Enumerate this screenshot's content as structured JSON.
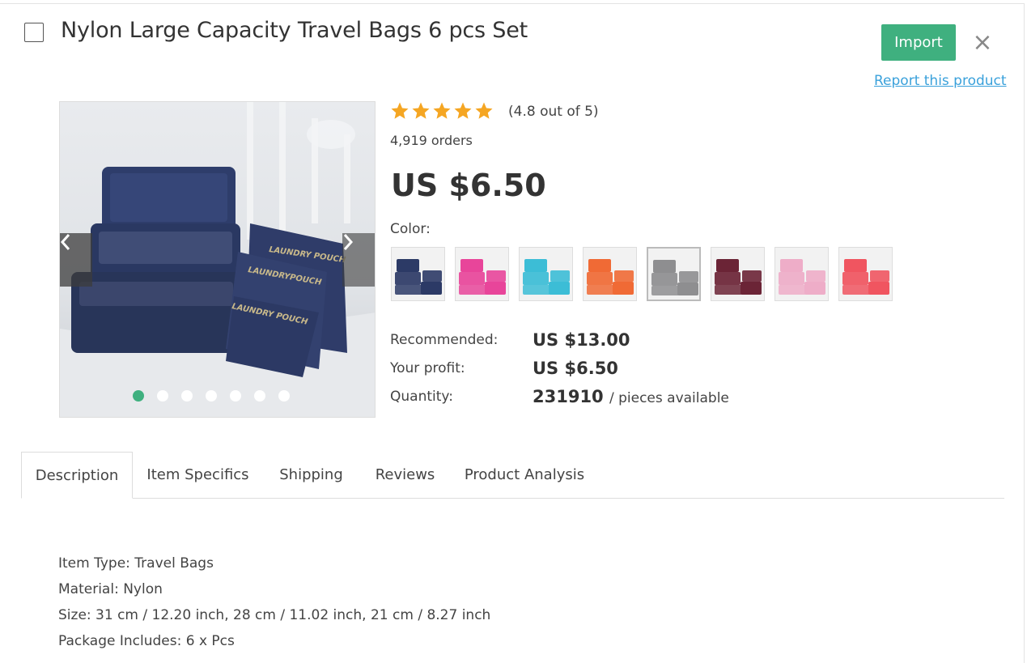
{
  "product": {
    "title": "Nylon Large Capacity Travel Bags 6 pcs Set",
    "import_label": "Import",
    "close_label": "×",
    "report_label": "Report this product",
    "rating_value": 4.8,
    "rating_text": "(4.8 out of 5)",
    "orders_text": "4,919 orders",
    "price": "US $6.50",
    "color_label": "Color:",
    "colors": [
      {
        "name": "navy",
        "hex": "#2c3a66"
      },
      {
        "name": "rose-pink",
        "hex": "#e8459a"
      },
      {
        "name": "sky-blue",
        "hex": "#3cbdd6"
      },
      {
        "name": "orange",
        "hex": "#f06a35"
      },
      {
        "name": "gray",
        "hex": "#8e8e90"
      },
      {
        "name": "wine",
        "hex": "#6b2436"
      },
      {
        "name": "light-pink",
        "hex": "#eeadc8"
      },
      {
        "name": "watermelon",
        "hex": "#f05560"
      }
    ],
    "recommended_label": "Recommended:",
    "recommended_value": "US $13.00",
    "profit_label": "Your profit:",
    "profit_value": "US $6.50",
    "quantity_label": "Quantity:",
    "quantity_value": "231910",
    "quantity_suffix": "/ pieces available",
    "image_dots_count": 7,
    "image_dot_active": 1,
    "image_pouch_texts": [
      "LAUNDRY POUCH",
      "LAUNDRYPOUCH",
      "LAUNDRY POUCH"
    ]
  },
  "tabs": [
    {
      "label": "Description",
      "active": true
    },
    {
      "label": "Item Specifics",
      "active": false
    },
    {
      "label": "Shipping",
      "active": false
    },
    {
      "label": "Reviews",
      "active": false
    },
    {
      "label": "Product Analysis",
      "active": false
    }
  ],
  "description": [
    "Item Type: Travel Bags",
    "Material: Nylon",
    "Size: 31 cm / 12.20 inch, 28 cm / 11.02 inch, 21 cm / 8.27 inch",
    "Package Includes: 6 x Pcs"
  ],
  "colors": {
    "accent": "#3fb07f",
    "link": "#3aa1db",
    "star": "#f5a623"
  }
}
